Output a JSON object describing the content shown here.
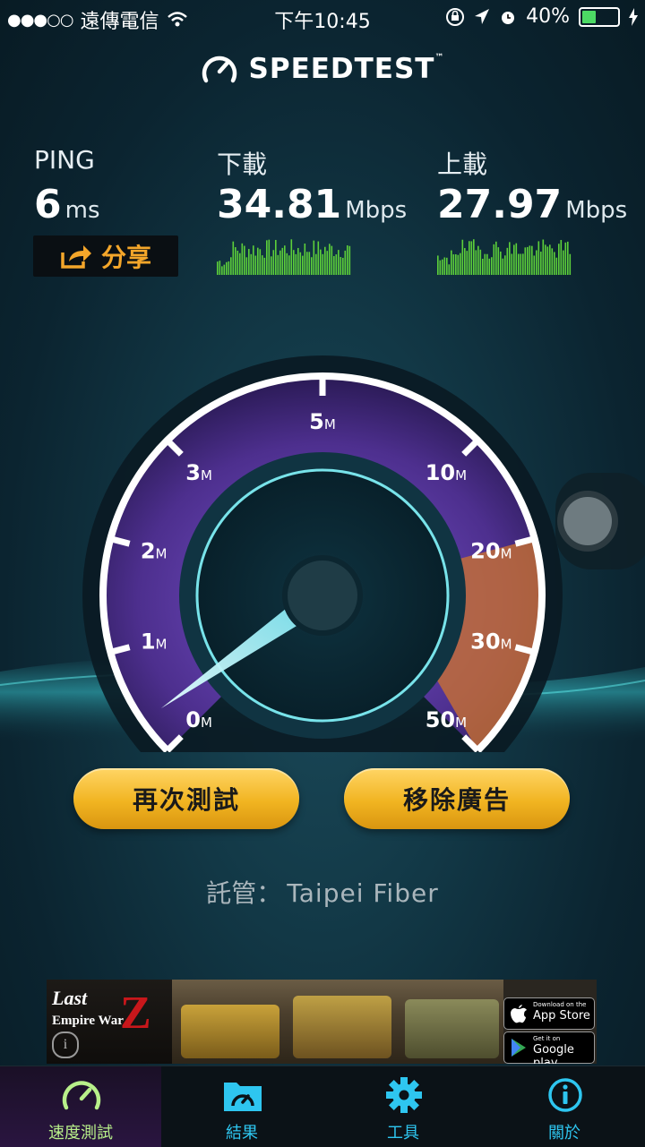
{
  "status_bar": {
    "signal": "●●●○○",
    "carrier": "遠傳電信",
    "time": "下午10:45",
    "battery_percent": "40%",
    "battery_level": 0.4
  },
  "app": {
    "title": "SPEEDTEST",
    "trademark": "™"
  },
  "results": {
    "ping": {
      "label": "PING",
      "value": "6",
      "unit": "ms"
    },
    "download": {
      "label": "下載",
      "value": "34.81",
      "unit": "Mbps"
    },
    "upload": {
      "label": "上載",
      "value": "27.97",
      "unit": "Mbps"
    },
    "share_label": "分享"
  },
  "gauge": {
    "ticks": [
      {
        "num": "0",
        "unit": "M"
      },
      {
        "num": "1",
        "unit": "M"
      },
      {
        "num": "2",
        "unit": "M"
      },
      {
        "num": "3",
        "unit": "M"
      },
      {
        "num": "5",
        "unit": "M"
      },
      {
        "num": "10",
        "unit": "M"
      },
      {
        "num": "20",
        "unit": "M"
      },
      {
        "num": "30",
        "unit": "M"
      },
      {
        "num": "50",
        "unit": "M"
      }
    ]
  },
  "buttons": {
    "retest": "再次測試",
    "remove_ads": "移除廣告"
  },
  "host": {
    "label": "託管：",
    "name": "Taipei Fiber"
  },
  "ad": {
    "brand_line1": "Last",
    "brand_line2": "Empire War",
    "brand_z": "Z",
    "info": "i",
    "appstore_small": "Download on the",
    "appstore_big": "App Store",
    "google_small": "Get it on",
    "google_big": "Google play"
  },
  "tabs": [
    {
      "label": "速度測試",
      "icon": "speedometer-icon",
      "active": true
    },
    {
      "label": "結果",
      "icon": "results-folder-icon",
      "active": false
    },
    {
      "label": "工具",
      "icon": "gear-icon",
      "active": false
    },
    {
      "label": "關於",
      "icon": "info-icon",
      "active": false
    }
  ],
  "colors": {
    "accent_orange": "#f4a62a",
    "tab_blue": "#2ec6f0",
    "tab_active": "#b8f08a",
    "gauge_purple": "#6a3fb0",
    "gauge_orange": "#e07a2e"
  }
}
